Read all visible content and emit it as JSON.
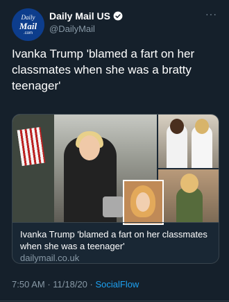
{
  "account": {
    "avatar_line1": "Daily",
    "avatar_line2": "Mail",
    "avatar_line3": ".com",
    "display_name": "Daily Mail US",
    "handle": "@DailyMail",
    "verified": true
  },
  "more_icon": "more-horizontal-icon",
  "tweet": {
    "text": "Ivanka Trump 'blamed a fart on her classmates when she was a bratty teenager'"
  },
  "link_card": {
    "title": "Ivanka Trump 'blamed a fart on her classmates when she was a teenager'",
    "domain": "dailymail.co.uk"
  },
  "footer": {
    "time": "7:50 AM",
    "separator1": " · ",
    "date": "11/18/20",
    "separator2": " · ",
    "source": "SocialFlow"
  },
  "colors": {
    "background": "#15202b",
    "secondary_text": "#8899a6",
    "accent": "#1da1f2",
    "border": "#38444d"
  }
}
